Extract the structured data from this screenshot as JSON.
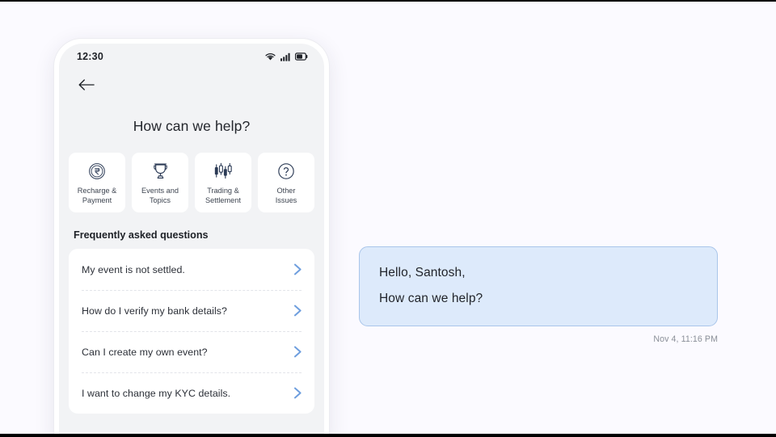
{
  "colors": {
    "page_bg": "#fbfaff",
    "phone_screen_bg": "#f2f3f5",
    "card_bg": "#ffffff",
    "bubble_bg": "#ddeafb",
    "bubble_border": "#a9c5ea",
    "chevron_blue": "#6e9ede",
    "text_primary": "#23262c",
    "text_muted": "#8a8f98"
  },
  "phone": {
    "status_bar": {
      "time": "12:30",
      "icons": [
        "wifi-icon",
        "cellular-signal-icon",
        "battery-icon"
      ]
    },
    "nav": {
      "back_icon": "back-arrow-icon"
    },
    "screen_title": "How can we help?",
    "categories": [
      {
        "icon": "rupee-coin-icon",
        "label": "Recharge &\nPayment"
      },
      {
        "icon": "trophy-icon",
        "label": "Events and\nTopics"
      },
      {
        "icon": "candlestick-icon",
        "label": "Trading &\nSettlement"
      },
      {
        "icon": "question-mark-icon",
        "label": "Other\nIssues"
      }
    ],
    "faq": {
      "heading": "Frequently asked questions",
      "items": [
        {
          "question": "My event is not settled.",
          "chevron": "chevron-right-icon"
        },
        {
          "question": "How do I verify my bank details?",
          "chevron": "chevron-right-icon"
        },
        {
          "question": "Can I create my own event?",
          "chevron": "chevron-right-icon"
        },
        {
          "question": "I want to change my KYC details.",
          "chevron": "chevron-right-icon"
        }
      ]
    }
  },
  "chat": {
    "message": {
      "line1": "Hello, Santosh,",
      "line2": "How can we help?"
    },
    "timestamp": "Nov 4, 11:16 PM"
  }
}
